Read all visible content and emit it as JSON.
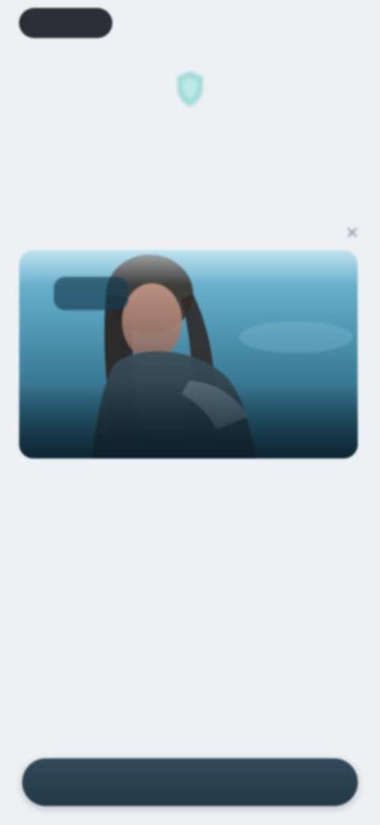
{
  "colors": {
    "background": "#eef1f4",
    "topPill": "#2b2e33",
    "accent": "#8fd7d2",
    "buttonDark": "#233847",
    "videoTop": "#7ebfd7",
    "videoBottom": "#1f4f66"
  },
  "header": {
    "logo_icon": "teal-shield-icon",
    "title": "",
    "pill_label": ""
  },
  "content": {
    "section_label": "",
    "close_icon": "close-icon",
    "video": {
      "thumbnail_icon": "video-thumbnail",
      "badge_text": ""
    },
    "description": ""
  },
  "footer": {
    "cta_label": ""
  }
}
